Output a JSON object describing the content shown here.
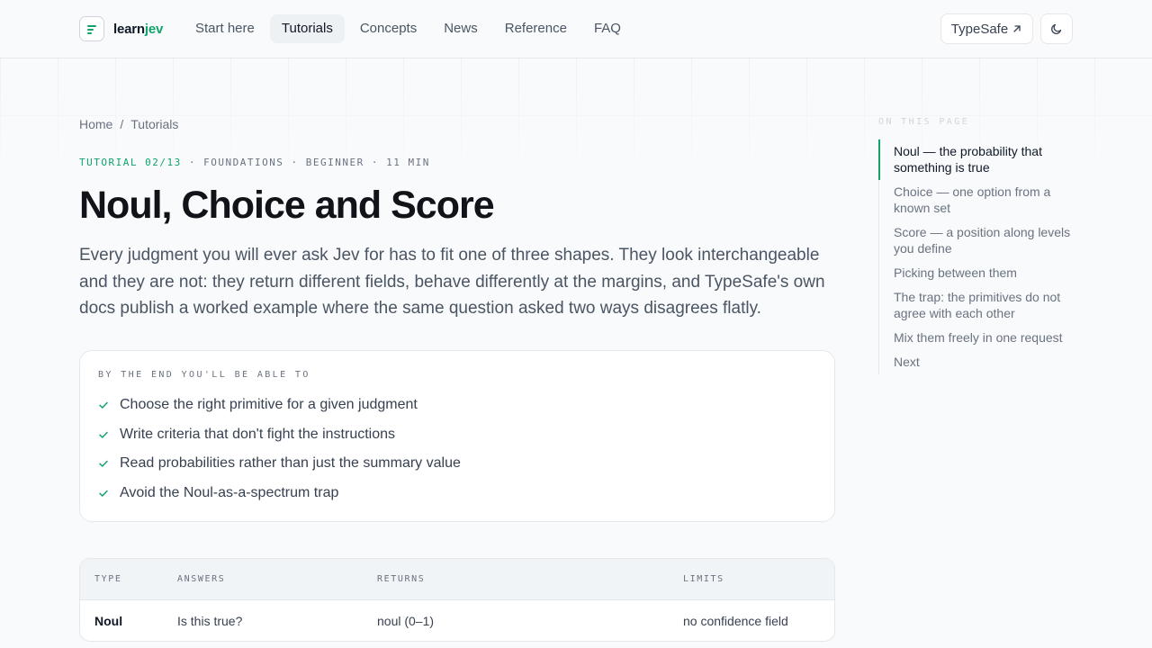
{
  "brand": {
    "part1": "learn",
    "part2": "jev"
  },
  "nav": {
    "items": [
      {
        "label": "Start here",
        "active": false
      },
      {
        "label": "Tutorials",
        "active": true
      },
      {
        "label": "Concepts",
        "active": false
      },
      {
        "label": "News",
        "active": false
      },
      {
        "label": "Reference",
        "active": false
      },
      {
        "label": "FAQ",
        "active": false
      }
    ],
    "external_label": "TypeSafe",
    "external_icon": "arrow-up-right-icon",
    "theme_icon": "moon-icon"
  },
  "breadcrumb": {
    "home": "Home",
    "separator": "/",
    "current": "Tutorials"
  },
  "article": {
    "meta_accent": "TUTORIAL 02/13",
    "meta_rest": " · FOUNDATIONS · BEGINNER · 11 MIN",
    "title": "Noul, Choice and Score",
    "lede": "Every judgment you will ever ask Jev for has to fit one of three shapes. They look interchangeable and they are not: they return different fields, behave differently at the margins, and TypeSafe's own docs publish a worked example where the same question asked two ways disagrees flatly."
  },
  "goals": {
    "title": "BY THE END YOU'LL BE ABLE TO",
    "items": [
      "Choose the right primitive for a given judgment",
      "Write criteria that don't fight the instructions",
      "Read probabilities rather than just the summary value",
      "Avoid the Noul-as-a-spectrum trap"
    ]
  },
  "table": {
    "headers": {
      "type": "TYPE",
      "answers": "ANSWERS",
      "returns": "RETURNS",
      "limits": "LIMITS"
    },
    "rows": [
      {
        "type": "Noul",
        "answers": "Is this true?",
        "returns": "noul (0–1)",
        "limits": "no confidence field"
      }
    ]
  },
  "toc": {
    "title": "ON THIS PAGE",
    "items": [
      "Noul — the probability that something is true",
      "Choice — one option from a known set",
      "Score — a position along levels you define",
      "Picking between them",
      "The trap: the primitives do not agree with each other",
      "Mix them freely in one request",
      "Next"
    ],
    "active_index": 0
  },
  "colors": {
    "accent": "#10a36a",
    "text": "#111827",
    "muted": "#6b7280",
    "border": "#e5e7eb",
    "background": "#f8fafc"
  }
}
